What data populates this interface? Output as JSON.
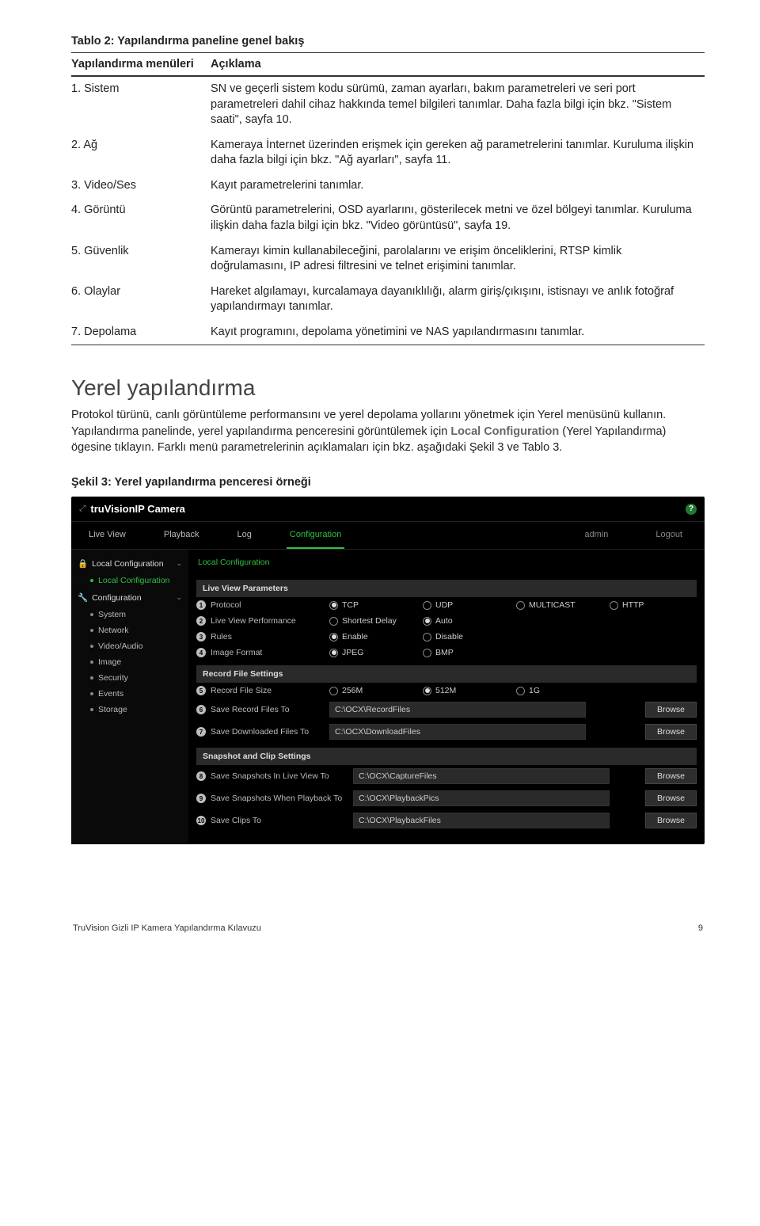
{
  "tableCaption": "Tablo 2: Yapılandırma paneline genel bakış",
  "th1": "Yapılandırma menüleri",
  "th2": "Açıklama",
  "rows": [
    {
      "c1": "1. Sistem",
      "c2": "SN ve geçerli sistem kodu sürümü, zaman ayarları, bakım parametreleri ve seri port parametreleri dahil cihaz hakkında temel bilgileri tanımlar. Daha fazla bilgi için bkz. \"Sistem saati\", sayfa 10."
    },
    {
      "c1": "2. Ağ",
      "c2": "Kameraya İnternet üzerinden erişmek için gereken ağ parametrelerini tanımlar. Kuruluma ilişkin daha fazla bilgi için bkz. \"Ağ ayarları\", sayfa 11."
    },
    {
      "c1": "3. Video/Ses",
      "c2": "Kayıt parametrelerini tanımlar."
    },
    {
      "c1": "4. Görüntü",
      "c2": "Görüntü parametrelerini, OSD ayarlarını, gösterilecek metni ve özel bölgeyi tanımlar. Kuruluma ilişkin daha fazla bilgi için bkz. \"Video görüntüsü\", sayfa 19."
    },
    {
      "c1": "5. Güvenlik",
      "c2": "Kamerayı kimin kullanabileceğini, parolalarını ve erişim önceliklerini, RTSP kimlik doğrulamasını, IP adresi filtresini ve telnet erişimini tanımlar."
    },
    {
      "c1": "6. Olaylar",
      "c2": "Hareket algılamayı, kurcalamaya dayanıklılığı, alarm giriş/çıkışını, istisnayı ve anlık fotoğraf yapılandırmayı tanımlar."
    },
    {
      "c1": "7. Depolama",
      "c2": "Kayıt programını, depolama yönetimini ve NAS yapılandırmasını tanımlar."
    }
  ],
  "sectionHeading": "Yerel yapılandırma",
  "para1a": "Protokol türünü, canlı görüntüleme performansını ve yerel depolama yollarını yönetmek için Yerel menüsünü kullanın. Yapılandırma panelinde, yerel yapılandırma penceresini görüntülemek için ",
  "para1b": "Local Configuration",
  "para1c": " (Yerel Yapılandırma) ögesine tıklayın. Farklı menü parametrelerinin açıklamaları için bkz. aşağıdaki Şekil 3 ve Tablo 3.",
  "figCaption": "Şekil 3: Yerel yapılandırma penceresi örneği",
  "shot": {
    "brand1": "truVision",
    "brand2": "IP Camera",
    "tabs": {
      "live": "Live View",
      "pb": "Playback",
      "log": "Log",
      "cfg": "Configuration",
      "admin": "admin",
      "logout": "Logout"
    },
    "side": {
      "g1": "Local Configuration",
      "g1i1": "Local Configuration",
      "g2": "Configuration",
      "items": [
        "System",
        "Network",
        "Video/Audio",
        "Image",
        "Security",
        "Events",
        "Storage"
      ]
    },
    "crumb": "Local Configuration",
    "panel1": "Live View Parameters",
    "r1": {
      "l": "Protocol",
      "o": [
        "TCP",
        "UDP",
        "MULTICAST",
        "HTTP"
      ],
      "sel": 0
    },
    "r2": {
      "l": "Live View Performance",
      "o": [
        "Shortest Delay",
        "Auto"
      ],
      "sel": 1
    },
    "r3": {
      "l": "Rules",
      "o": [
        "Enable",
        "Disable"
      ],
      "sel": 0
    },
    "r4": {
      "l": "Image Format",
      "o": [
        "JPEG",
        "BMP"
      ],
      "sel": 0
    },
    "panel2": "Record File Settings",
    "r5": {
      "l": "Record File Size",
      "o": [
        "256M",
        "512M",
        "1G"
      ],
      "sel": 1
    },
    "r6": {
      "l": "Save Record Files To",
      "v": "C:\\OCX\\RecordFiles"
    },
    "r7": {
      "l": "Save Downloaded Files To",
      "v": "C:\\OCX\\DownloadFiles"
    },
    "panel3": "Snapshot and Clip Settings",
    "r8": {
      "l": "Save Snapshots In Live View To",
      "v": "C:\\OCX\\CaptureFiles"
    },
    "r9": {
      "l": "Save Snapshots When Playback To",
      "v": "C:\\OCX\\PlaybackPics"
    },
    "r10": {
      "l": "Save Clips To",
      "v": "C:\\OCX\\PlaybackFiles"
    },
    "browse": "Browse"
  },
  "footer": {
    "left": "TruVision Gizli IP Kamera Yapılandırma Kılavuzu",
    "right": "9"
  }
}
